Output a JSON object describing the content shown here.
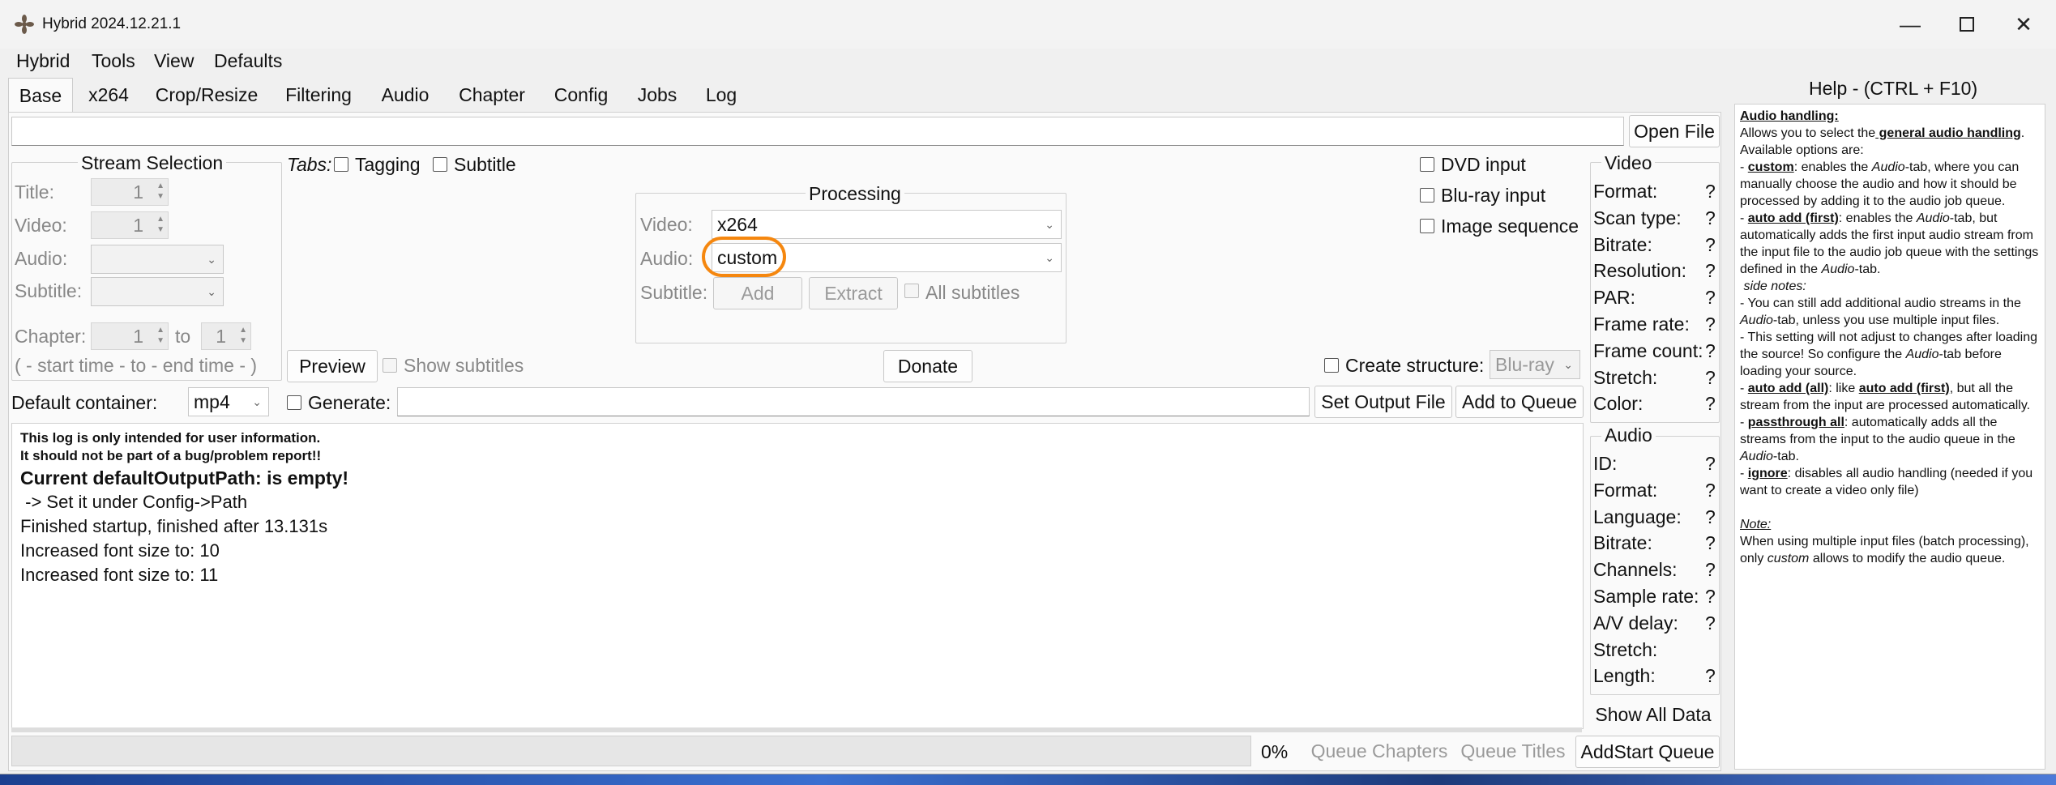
{
  "window": {
    "title": "Hybrid 2024.12.21.1",
    "logo": "hybrid-logo-icon"
  },
  "menu": [
    "Hybrid",
    "Tools",
    "View",
    "Defaults"
  ],
  "tabs": [
    "Base",
    "x264",
    "Crop/Resize",
    "Filtering",
    "Audio",
    "Chapter",
    "Config",
    "Jobs",
    "Log"
  ],
  "file": {
    "open_file": "Open File"
  },
  "stream_selection": {
    "title": "Stream Selection",
    "title_label": "Title:",
    "title_value": "1",
    "video_label": "Video:",
    "video_value": "1",
    "audio_label": "Audio:",
    "subtitle_label": "Subtitle:",
    "chapter_label": "Chapter:",
    "chapter_from": "1",
    "to_label": "to",
    "chapter_to": "1",
    "time_hint": "( - start time - to - end time - )"
  },
  "tabs_row": {
    "label": "Tabs:",
    "tagging": "Tagging",
    "subtitle": "Subtitle"
  },
  "processing": {
    "title": "Processing",
    "video_label": "Video:",
    "video_value": "x264",
    "audio_label": "Audio:",
    "audio_value": "custom",
    "subtitle_label": "Subtitle:",
    "add": "Add",
    "extract": "Extract",
    "all_subtitles": "All subtitles"
  },
  "inputs": {
    "dvd": "DVD input",
    "bluray": "Blu-ray input",
    "image_sequence": "Image sequence"
  },
  "preview": {
    "button": "Preview",
    "show_subtitles": "Show subtitles"
  },
  "donate": "Donate",
  "structure": {
    "label": "Create structure:",
    "value": "Blu-ray"
  },
  "output": {
    "default_container": "Default container:",
    "container_value": "mp4",
    "generate": "Generate:",
    "set_output": "Set Output File",
    "add_queue": "Add to Queue"
  },
  "log": [
    {
      "text": "This log is only intended for user information.",
      "style": "small-bold"
    },
    {
      "text": "It should not be part of a bug/problem report!!",
      "style": "small-bold"
    },
    {
      "text": "Current defaultOutputPath: is empty!",
      "style": "large-bold"
    },
    {
      "text": " -> Set it under Config->Path",
      "style": "normal"
    },
    {
      "text": "Finished startup, finished after 13.131s",
      "style": "normal"
    },
    {
      "text": "Increased font size to: 10",
      "style": "normal"
    },
    {
      "text": "Increased font size to: 11",
      "style": "normal"
    }
  ],
  "video_info": {
    "title": "Video",
    "fields": [
      "Format:",
      "Scan type:",
      "Bitrate:",
      "Resolution:",
      "PAR:",
      "Frame rate:",
      "Frame count:",
      "Stretch:",
      "Color:"
    ],
    "unknown": "?"
  },
  "audio_info": {
    "title": "Audio",
    "fields": [
      "ID:",
      "Format:",
      "Language:",
      "Bitrate:",
      "Channels:",
      "Sample rate:",
      "A/V delay:",
      "Stretch:",
      "Length:"
    ],
    "has_q": [
      true,
      true,
      true,
      true,
      true,
      true,
      true,
      false,
      true
    ],
    "unknown": "?"
  },
  "show_all_data": "Show All Data",
  "bottom": {
    "progress": "0%",
    "progress_value": 0,
    "queue_chapters": "Queue Chapters",
    "queue_titles": "Queue Titles",
    "add_start": "AddStart Queue"
  },
  "help": {
    "title": "Help - (CTRL + F10)",
    "heading": "Audio handling:",
    "p1_a": "Allows you to select the",
    "p1_b": " general audio handling",
    ". ": "",
    "available": "Available options are:",
    "opt_custom_k": "custom",
    "opt_custom_t": ": enables the ",
    "opt_custom_i": "Audio",
    "opt_custom_t2": "-tab, where you can manually choose the audio and how it should be processed by adding it to the audio job queue.",
    "opt_first_k": "auto add (first)",
    "opt_first_t": ":  enables the ",
    "opt_first_i": "Audio",
    "opt_first_t2": "-tab, but automatically adds the first input audio stream from the input file to the audio job queue with the settings defined in the ",
    "opt_first_i2": "Audio",
    "opt_first_t3": "-tab.",
    "side_notes": " side notes:",
    "sn1_a": " - You can still add additional audio streams in the ",
    "sn1_i": "Audio",
    "sn1_b": "-tab, unless you use multiple input files.",
    "sn2_a": " - This setting will not adjust to changes after loading the source! So configure the ",
    "sn2_i": "Audio",
    "sn2_b": "-tab before loading your source.",
    "opt_all_k": "auto add (all)",
    "opt_all_t": ": like ",
    "opt_all_k2": "auto add (first)",
    "opt_all_t2": ", but all the stream from the input are processed automatically.",
    "opt_pass_k": "passthrough all",
    "opt_pass_t": ": automatically adds all the streams from the input to the audio queue in the ",
    "opt_pass_i": "Audio",
    "opt_pass_t2": "-tab.",
    "opt_ign_k": "ignore",
    "opt_ign_t": ": disables all audio handling (needed if you want to create a video only file)",
    "note_h": "Note:",
    "note_a": "When using multiple input files (batch processing), only ",
    "note_i": "custom",
    "note_b": " allows to modify the audio queue."
  },
  "colors": {
    "highlight": "#f5870f",
    "window": "#f0f0f0",
    "panel": "#fafafa"
  }
}
